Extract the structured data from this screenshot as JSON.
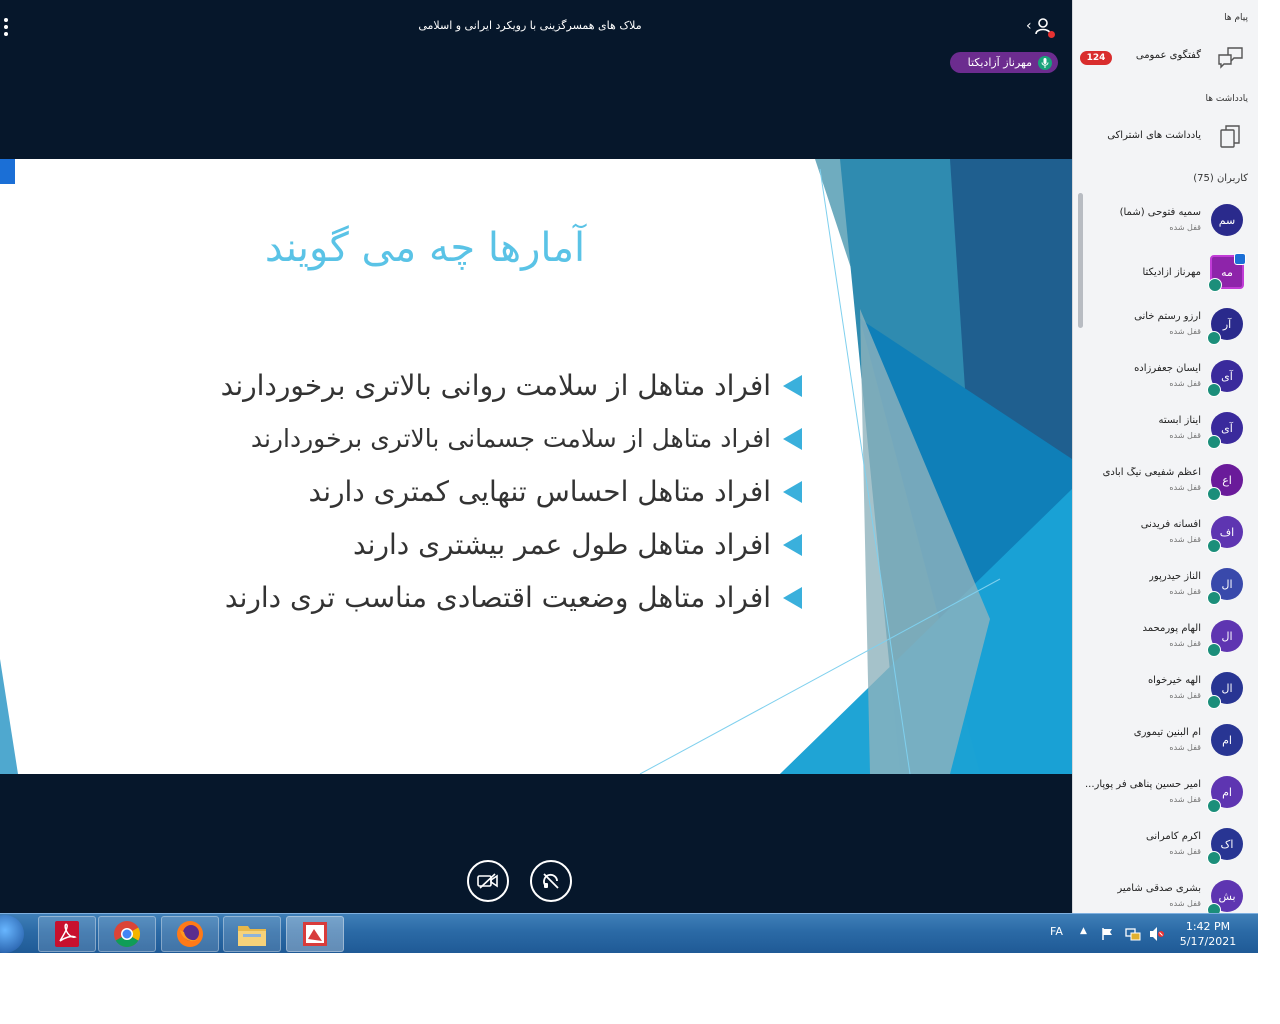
{
  "meeting": {
    "title": "ملاک های همسرگزینی با رویکرد ایرانی و اسلامی",
    "talker_name": "مهرناز آزادیکتا"
  },
  "slide": {
    "title": "آمارها چه می گویند",
    "bullets": [
      "افراد متاهل از سلامت روانی بالاتری برخوردارند",
      "افراد متاهل از سلامت جسمانی بالاتری برخوردارند",
      "افراد متاهل احساس تنهایی کمتری دارند",
      "افراد متاهل طول عمر بیشتری دارند",
      "افراد متاهل وضعیت اقتصادی مناسب تری دارند"
    ],
    "accent_color": "#5ac3e6"
  },
  "panel": {
    "messages_label": "پیام ها",
    "public_chat_label": "گفتگوی عمومی",
    "public_chat_count": "124",
    "notes_label": "یادداشت ها",
    "shared_notes_label": "یادداشت های اشتراکی",
    "users_label": "کاربران (75)",
    "users": [
      {
        "initials": "سم",
        "name": "سمیه فتوحی (شما)",
        "status": "قفل شده",
        "color": "#2a2a8c",
        "has_status": false
      },
      {
        "initials": "مه",
        "name": "مهرناز آزادیکتا",
        "status": "",
        "color": "#8e24aa",
        "has_status": true
      },
      {
        "initials": "آر",
        "name": "آرزو رستم خانی",
        "status": "قفل شده",
        "color": "#2a2a8c",
        "has_status": true
      },
      {
        "initials": "آی",
        "name": "آیسان جعفرزاده",
        "status": "قفل شده",
        "color": "#3a2a9c",
        "has_status": true
      },
      {
        "initials": "آی",
        "name": "آیناز آبسته",
        "status": "قفل شده",
        "color": "#3a2a9c",
        "has_status": true
      },
      {
        "initials": "اع",
        "name": "اعظم شفیعی نیگ آبادی",
        "status": "قفل شده",
        "color": "#6a1b9a",
        "has_status": true
      },
      {
        "initials": "اف",
        "name": "افسانه فریدنی",
        "status": "قفل شده",
        "color": "#5e35b1",
        "has_status": true
      },
      {
        "initials": "ال",
        "name": "الناز حیدرپور",
        "status": "قفل شده",
        "color": "#3949ab",
        "has_status": true
      },
      {
        "initials": "ال",
        "name": "الهام پورمحمد",
        "status": "قفل شده",
        "color": "#5e35b1",
        "has_status": true
      },
      {
        "initials": "ال",
        "name": "الهه خیرخواه",
        "status": "قفل شده",
        "color": "#283593",
        "has_status": true
      },
      {
        "initials": "ام",
        "name": "ام البنین تیموری",
        "status": "قفل شده",
        "color": "#283593",
        "has_status": false
      },
      {
        "initials": "ام",
        "name": "امیر حسین پناهی فر پوپار...",
        "status": "قفل شده",
        "color": "#5e35b1",
        "has_status": true
      },
      {
        "initials": "اک",
        "name": "اکرم کامرانی",
        "status": "قفل شده",
        "color": "#283593",
        "has_status": true
      },
      {
        "initials": "بش",
        "name": "بشری صدقی شامیر",
        "status": "قفل شده",
        "color": "#5e35b1",
        "has_status": true
      }
    ]
  },
  "taskbar": {
    "lang": "FA",
    "time": "1:42 PM",
    "date": "5/17/2021"
  }
}
